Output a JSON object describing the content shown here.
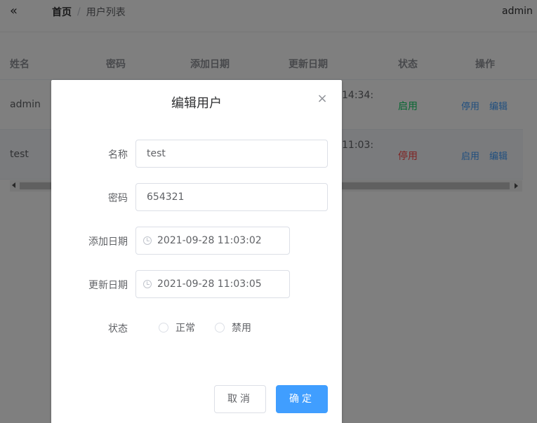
{
  "header": {
    "breadcrumb": {
      "home": "首页",
      "separator": "/",
      "current": "用户列表"
    },
    "user": "admin"
  },
  "table": {
    "columns": [
      "姓名",
      "密码",
      "添加日期",
      "更新日期",
      "状态",
      "操作"
    ],
    "rows": [
      {
        "name": "admin",
        "time": "14:34:",
        "status": "启用",
        "action1": "停用",
        "action2": "编辑"
      },
      {
        "name": "test",
        "time": "11:03:",
        "status": "停用",
        "action1": "启用",
        "action2": "编辑"
      }
    ]
  },
  "dialog": {
    "title": "编辑用户",
    "fields": {
      "name": {
        "label": "名称",
        "value": "test"
      },
      "password": {
        "label": "密码",
        "value": "654321"
      },
      "created": {
        "label": "添加日期",
        "value": "2021-09-28 11:03:02"
      },
      "updated": {
        "label": "更新日期",
        "value": "2021-09-28 11:03:05"
      },
      "status": {
        "label": "状态",
        "options": [
          "正常",
          "禁用"
        ]
      }
    },
    "buttons": {
      "cancel": "取消",
      "confirm": "确定"
    }
  },
  "colors": {
    "primary": "#409eff",
    "enabled": "#13ce66",
    "disabled": "#ff4949"
  }
}
